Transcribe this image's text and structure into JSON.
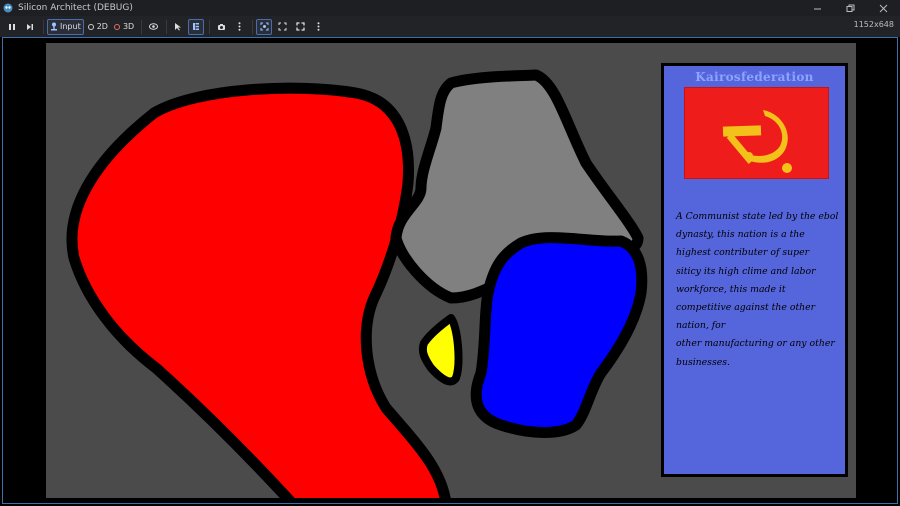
{
  "window": {
    "title": "Silicon Architect (DEBUG)",
    "controls": [
      "minimize",
      "restore",
      "close"
    ]
  },
  "toolbar": {
    "input_label": "Input",
    "mode_2d_label": "2D",
    "mode_3d_label": "3D",
    "resolution": "1152x648"
  },
  "map": {
    "regions": [
      {
        "name": "red-region",
        "color": "#ff0000"
      },
      {
        "name": "gray-region",
        "color": "#808080"
      },
      {
        "name": "blue-region",
        "color": "#0000ff"
      },
      {
        "name": "yellow-region",
        "color": "#ffff00"
      }
    ]
  },
  "info_panel": {
    "nation_name": "Kairosfederation",
    "flag": {
      "background": "#ef1c1c",
      "emblem": "hammer-and-sickle-icon",
      "emblem_color": "#f2c21a"
    },
    "description": "A Communist state led by the ebol dynasty, this nation is a the highest contributer of super\nsiticy its high clime and labor workforce, this made it competitive against the other nation, for\nother manufacturing or any other businesses."
  }
}
